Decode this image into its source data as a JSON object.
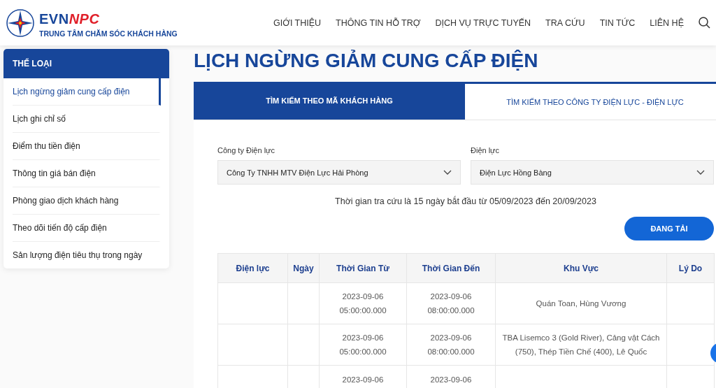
{
  "logo": {
    "brand_main": "EVN",
    "brand_accent": "NPC",
    "tagline": "TRUNG TÂM CHĂM SÓC KHÁCH HÀNG"
  },
  "nav": [
    {
      "label": "GIỚI THIỆU"
    },
    {
      "label": "THÔNG TIN HỖ TRỢ"
    },
    {
      "label": "DỊCH VỤ TRỰC TUYẾN"
    },
    {
      "label": "TRA CỨU"
    },
    {
      "label": "TIN TỨC"
    },
    {
      "label": "LIÊN HỆ"
    }
  ],
  "sidebar": {
    "title": "THỂ LOẠI",
    "items": [
      {
        "label": "Lịch ngừng giảm cung cấp điện",
        "selected": true
      },
      {
        "label": "Lịch ghi chỉ số",
        "selected": false
      },
      {
        "label": "Điểm thu tiền điện",
        "selected": false
      },
      {
        "label": "Thông tin giá bán điện",
        "selected": false
      },
      {
        "label": "Phòng giao dịch khách hàng",
        "selected": false
      },
      {
        "label": "Theo dõi tiến độ cấp điện",
        "selected": false
      },
      {
        "label": "Sản lượng điện tiêu thụ trong ngày",
        "selected": false
      }
    ]
  },
  "page_title": "LỊCH NGỪNG GIẢM CUNG CẤP ĐIỆN",
  "tabs": [
    {
      "label": "TÌM KIẾM THEO MÃ KHÁCH HÀNG",
      "selected": false
    },
    {
      "label": "TÌM KIẾM THEO CÔNG TY ĐIỆN LỰC - ĐIỆN LỰC",
      "selected": true
    }
  ],
  "filters": [
    {
      "label": "Công ty Điện lực",
      "value": "Công Ty TNHH MTV Điện Lực Hải Phòng"
    },
    {
      "label": "Điện lực",
      "value": "Điện Lực Hồng Bàng"
    }
  ],
  "range_note": "Thời gian tra cứu là 15 ngày bắt đầu từ 05/09/2023 đến 20/09/2023",
  "load_button": "ĐANG TẢI",
  "table": {
    "columns": [
      "Điện lực",
      "Ngày",
      "Thời Gian Từ",
      "Thời Gian Đến",
      "Khu Vực",
      "Lý Do"
    ],
    "rows": [
      [
        "",
        "",
        "2023-09-06 05:00:00.000",
        "2023-09-06 08:00:00.000",
        "Quán Toan, Hùng Vương",
        ""
      ],
      [
        "",
        "",
        "2023-09-06 05:00:00.000",
        "2023-09-06 08:00:00.000",
        "TBA Lisemco 3 (Gold River), Cảng vật Cách (750), Thép Tiền Chế (400), Lê Quốc",
        ""
      ],
      [
        "",
        "",
        "2023-09-06",
        "2023-09-06",
        "",
        ""
      ]
    ]
  }
}
